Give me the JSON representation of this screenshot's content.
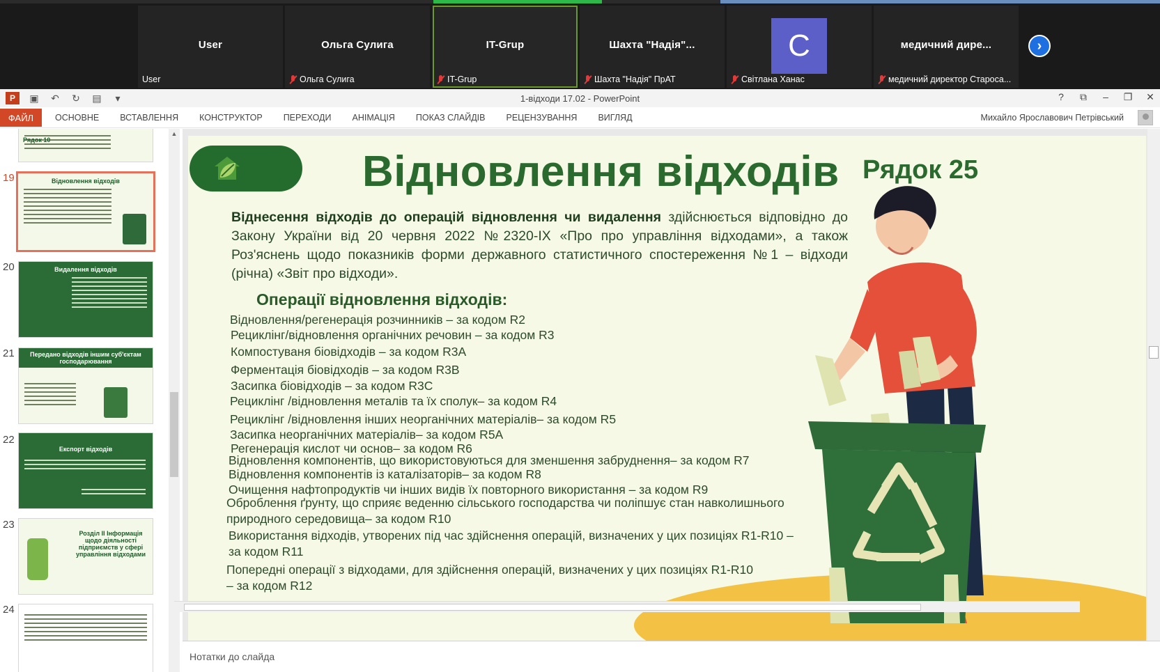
{
  "zoom": {
    "participants": [
      {
        "name": "User",
        "label": "User",
        "muted": false
      },
      {
        "name": "Ольга Сулига",
        "label": "Ольга Сулига",
        "muted": true
      },
      {
        "name": "IT-Grup",
        "label": "IT-Grup",
        "muted": true,
        "active": true
      },
      {
        "name": "Шахта  \"Надія\"...",
        "label": "Шахта \"Надія\" ПрАТ",
        "muted": true
      },
      {
        "name": "",
        "label": "Світлана Ханас",
        "muted": true,
        "avatar_letter": "C"
      },
      {
        "name": "медичний  дире...",
        "label": "медичний директор Староса...",
        "muted": true
      }
    ],
    "next_icon": "chevron-right-icon"
  },
  "window": {
    "title": "1-відходи 17.02 - PowerPoint",
    "controls": [
      "?",
      "⧉",
      "–",
      "❐",
      "✕"
    ]
  },
  "ribbon": {
    "file_tab": "ФАЙЛ",
    "tabs": [
      "ОСНОВНЕ",
      "ВСТАВЛЕННЯ",
      "КОНСТРУКТОР",
      "ПЕРЕХОДИ",
      "АНІМАЦІЯ",
      "ПОКАЗ СЛАЙДІВ",
      "РЕЦЕНЗУВАННЯ",
      "ВИГЛЯД"
    ],
    "user": "Михайло Ярославович Петрівський"
  },
  "thumbnails": [
    {
      "num": "",
      "title": "Рядок 10"
    },
    {
      "num": "19",
      "title": "Відновлення відходів",
      "selected": true
    },
    {
      "num": "20",
      "title": "Видалення відходів"
    },
    {
      "num": "21",
      "title": "Передано відходів іншим суб'єктам господарювання"
    },
    {
      "num": "22",
      "title": "Експорт відходів"
    },
    {
      "num": "23",
      "title": "Розділ II Інформація щодо діяльності підприємств у сфері управління відходами"
    },
    {
      "num": "24",
      "title": ""
    }
  ],
  "slide": {
    "title": "Відновлення відходів",
    "row_label": "Рядок 25",
    "intro_bold": "Віднесення відходів до операцій відновлення чи видалення",
    "intro_rest": " здійснюється відповідно до Закону України від 20 червня 2022 №2320-IX «Про  про управління відходами», а також Роз'яснень щодо показників форми  державного статистичного спостереження №1 – відходи (річна) «Звіт про відходи».",
    "ops_heading": "Операції відновлення відходів:",
    "operations": [
      "Відновлення/регенерація розчинників – за кодом R2",
      "Рециклінг/відновлення органічних речовин – за кодом R3",
      "Компостуваня біовідходів – за кодом R3A",
      "Ферментація біовідходів – за кодом R3B",
      "Засипка біовідходів – за кодом R3C",
      "Рециклінг /відновлення металів та їх сполук– за кодом R4",
      "Рециклінг /відновлення інших неорганічних матеріалів– за кодом R5",
      "Засипка неорганічних матеріалів– за кодом R5A",
      "Регенерація кислот чи основ– за кодом R6",
      "Відновлення компонентів, що використовуються для зменшення забруднення– за кодом R7",
      "Відновлення компонентів із каталізаторів– за кодом R8",
      "Очищення нафтопродуктів чи інших видів їх повторного використання – за кодом R9",
      "Оброблення ґрунту, що сприяє веденню сільського господарства чи поліпшує стан навколишнього природного  середовища– за кодом R10",
      "Використання відходів, утворених під час здійснення операцій, визначених у цих позиціях R1-R10 –  за кодом R11",
      "Попередні операції з відходами, для здійснення операцій, визначених у цих позиціях R1-R10 – за кодом R12"
    ]
  },
  "notes_placeholder": "Нотатки до слайда",
  "colors": {
    "accent": "#d24726",
    "slide_green": "#2a6a2e",
    "slide_bg": "#f6f9e5",
    "ground": "#f3c244"
  }
}
